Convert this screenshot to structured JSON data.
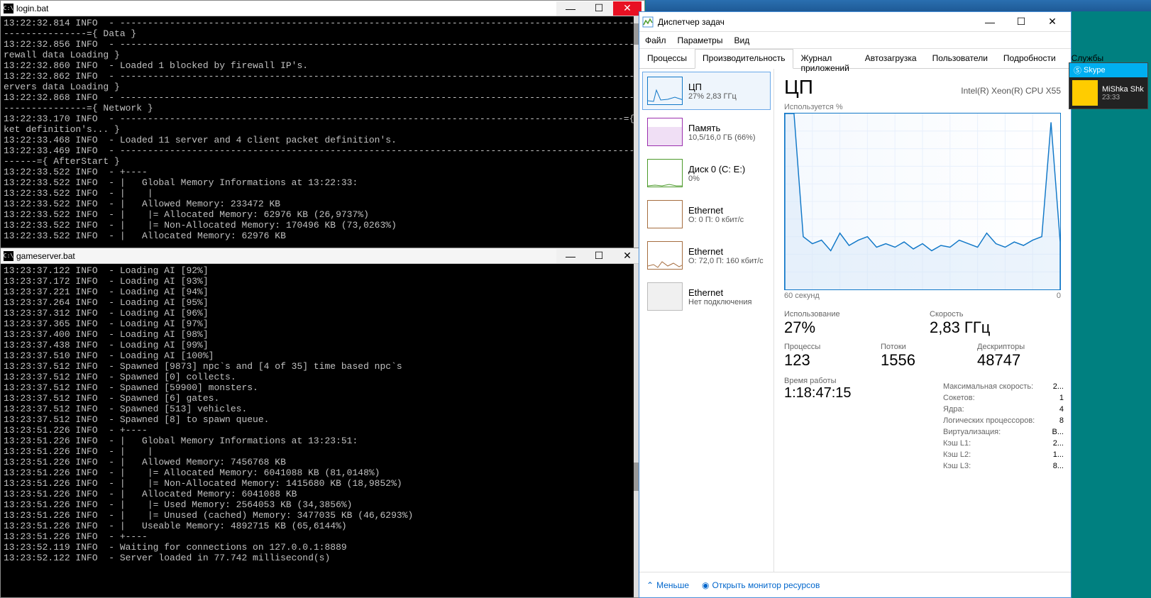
{
  "login_console": {
    "title": "login.bat",
    "lines": "13:22:32.814 INFO  - -----------------------------------------------------------------------------------------------\n---------------={ Data }\n13:22:32.856 INFO  - -----------------------------------------------------------------------------------------------------={ Fi\nrewall data Loading }\n13:22:32.860 INFO  - Loaded 1 blocked by firewall IP's.\n13:22:32.862 INFO  - -----------------------------------------------------------------------------------------------------={ GameS\nervers data Loading }\n13:22:32.868 INFO  - -----------------------------------------------------------------------------------------------\n---------------={ Network }\n13:22:33.170 INFO  - -------------------------------------------------------------------------------------------={ Loading pac\nket definition's... }\n13:22:33.468 INFO  - Loaded 11 server and 4 client packet definition's.\n13:22:33.469 INFO  - -----------------------------------------------------------------------------------------------\n------={ AfterStart }\n13:22:33.522 INFO  - +----\n13:22:33.522 INFO  - |   Global Memory Informations at 13:22:33:\n13:22:33.522 INFO  - |    |\n13:22:33.522 INFO  - |   Allowed Memory: 233472 KB\n13:22:33.522 INFO  - |    |= Allocated Memory: 62976 KB (26,9737%)\n13:22:33.522 INFO  - |    |= Non-Allocated Memory: 170496 KB (73,0263%)\n13:22:33.522 INFO  - |   Allocated Memory: 62976 KB"
  },
  "game_console": {
    "title": "gameserver.bat",
    "lines": "13:23:37.122 INFO  - Loading AI [92%]\n13:23:37.172 INFO  - Loading AI [93%]\n13:23:37.221 INFO  - Loading AI [94%]\n13:23:37.264 INFO  - Loading AI [95%]\n13:23:37.312 INFO  - Loading AI [96%]\n13:23:37.365 INFO  - Loading AI [97%]\n13:23:37.400 INFO  - Loading AI [98%]\n13:23:37.438 INFO  - Loading AI [99%]\n13:23:37.510 INFO  - Loading AI [100%]\n13:23:37.512 INFO  - Spawned [9873] npc`s and [4 of 35] time based npc`s\n13:23:37.512 INFO  - Spawned [0] collects.\n13:23:37.512 INFO  - Spawned [59900] monsters.\n13:23:37.512 INFO  - Spawned [6] gates.\n13:23:37.512 INFO  - Spawned [513] vehicles.\n13:23:37.512 INFO  - Spawned [8] to spawn queue.\n13:23:51.226 INFO  - +----\n13:23:51.226 INFO  - |   Global Memory Informations at 13:23:51:\n13:23:51.226 INFO  - |    |\n13:23:51.226 INFO  - |   Allowed Memory: 7456768 KB\n13:23:51.226 INFO  - |    |= Allocated Memory: 6041088 KB (81,0148%)\n13:23:51.226 INFO  - |    |= Non-Allocated Memory: 1415680 KB (18,9852%)\n13:23:51.226 INFO  - |   Allocated Memory: 6041088 KB\n13:23:51.226 INFO  - |    |= Used Memory: 2564053 KB (34,3856%)\n13:23:51.226 INFO  - |    |= Unused (cached) Memory: 3477035 KB (46,6293%)\n13:23:51.226 INFO  - |   Useable Memory: 4892715 KB (65,6144%)\n13:23:51.226 INFO  - +----\n13:23:52.119 INFO  - Waiting for connections on 127.0.0.1:8889\n13:23:52.122 INFO  - Server loaded in 77.742 millisecond(s)"
  },
  "taskmgr": {
    "title": "Диспетчер задач",
    "menu": {
      "file": "Файл",
      "options": "Параметры",
      "view": "Вид"
    },
    "tabs": {
      "processes": "Процессы",
      "performance": "Производительность",
      "app_history": "Журнал приложений",
      "startup": "Автозагрузка",
      "users": "Пользователи",
      "details": "Подробности",
      "services": "Службы"
    },
    "sidebar": {
      "cpu": {
        "title": "ЦП",
        "sub": "27% 2,83 ГГц"
      },
      "mem": {
        "title": "Память",
        "sub": "10,5/16,0 ГБ (66%)"
      },
      "disk": {
        "title": "Диск 0 (C: E:)",
        "sub": "0%"
      },
      "eth1": {
        "title": "Ethernet",
        "sub": "О: 0 П: 0 кбит/с"
      },
      "eth2": {
        "title": "Ethernet",
        "sub": "О: 72,0 П: 160 кбит/с"
      },
      "eth3": {
        "title": "Ethernet",
        "sub": "Нет подключения"
      }
    },
    "main": {
      "title": "ЦП",
      "subtitle": "Intel(R) Xeon(R) CPU X55",
      "chart_label_top": "Используется %",
      "axis_left": "60 секунд",
      "axis_right": "0",
      "stats": {
        "util_label": "Использование",
        "util_val": "27%",
        "speed_label": "Скорость",
        "speed_val": "2,83 ГГц",
        "proc_label": "Процессы",
        "proc_val": "123",
        "threads_label": "Потоки",
        "threads_val": "1556",
        "handles_label": "Дескрипторы",
        "handles_val": "48747",
        "uptime_label": "Время работы",
        "uptime_val": "1:18:47:15"
      },
      "right": {
        "maxspeed_k": "Максимальная скорость:",
        "maxspeed_v": "2...",
        "sockets_k": "Сокетов:",
        "sockets_v": "1",
        "cores_k": "Ядра:",
        "cores_v": "4",
        "logical_k": "Логических процессоров:",
        "logical_v": "8",
        "virt_k": "Виртуализация:",
        "virt_v": "В...",
        "l1_k": "Кэш L1:",
        "l1_v": "2...",
        "l2_k": "Кэш L2:",
        "l2_v": "1...",
        "l3_k": "Кэш L3:",
        "l3_v": "8..."
      }
    },
    "footer": {
      "less": "Меньше",
      "monitor": "Открыть монитор ресурсов"
    }
  },
  "skype": {
    "brand": "Skype",
    "name": "MiShka Shk",
    "time": "23:33"
  },
  "chart_data": {
    "type": "line",
    "title": "ЦП — Используется %",
    "xlabel": "60 секунд",
    "ylabel": "%",
    "ylim": [
      0,
      100
    ],
    "x": [
      0,
      2,
      4,
      6,
      8,
      10,
      12,
      14,
      16,
      18,
      20,
      22,
      24,
      26,
      28,
      30,
      32,
      34,
      36,
      38,
      40,
      42,
      44,
      46,
      48,
      50,
      52,
      54,
      56,
      58,
      60
    ],
    "series": [
      {
        "name": "Используется %",
        "values": [
          100,
          100,
          30,
          26,
          28,
          22,
          32,
          25,
          28,
          30,
          24,
          26,
          24,
          27,
          23,
          26,
          22,
          25,
          24,
          28,
          26,
          24,
          32,
          26,
          24,
          27,
          25,
          28,
          30,
          95,
          27
        ]
      }
    ]
  }
}
